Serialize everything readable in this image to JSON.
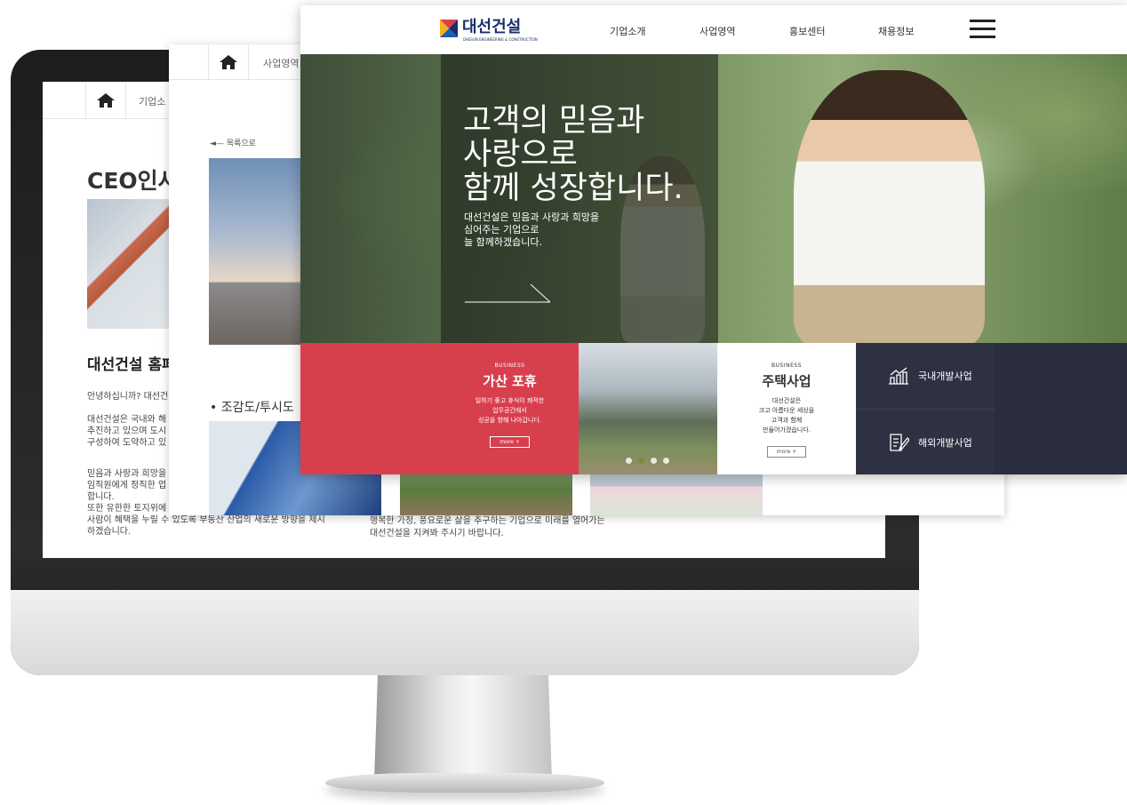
{
  "ceo_page": {
    "breadcrumb": "기업소",
    "title": "CEO인사",
    "heading": "대선건설 홈페",
    "para1": "안녕하십니까? 대선건",
    "para2": "대선건설은 국내와 해\n추진하고 있으며 도시\n구성하여 도약하고 있",
    "para3": "믿음과 사랑과 희망을\n임직원에게 정직한 업\n합니다.\n또한 유한한 토지위에 수많은 공동체를 만들어 문화의 어울림이 있는\n사람이 혜택을 누릴 수 있도록 부동산 산업의 새로운 방향을 제시\n하겠습니다."
  },
  "business_page": {
    "breadcrumb": "사업영역",
    "back_link": "◄— 목록으로",
    "section_title": "• 조감도/투시도",
    "bottom_text": "행복한 가정, 풍요로운 삶을 추구하는 기업으로 미래를 열어가는\n대선건설을 지켜봐 주시기 바랍니다."
  },
  "main_page": {
    "logo": {
      "name": "대선건설",
      "sub": "DAESUN ENGINEERING & CONSTRUCTION"
    },
    "menu": [
      "기업소개",
      "사업영역",
      "홍보센터",
      "채용정보"
    ],
    "hero": {
      "title": "고객의 믿음과\n사랑으로\n함께 성장합니다.",
      "description": "대선건설은 믿음과 사랑과 희망을\n심어주는 기업으로\n늘 함께하겠습니다."
    },
    "business_cards": [
      {
        "label": "BUSINESS",
        "title": "가산 포휴",
        "desc": "일하기 좋고 휴식이 쾌적한\n업무공간에서\n성공을 향해 나아갑니다.",
        "more": "more +"
      },
      {
        "label": "BUSINESS",
        "title": "주택사업",
        "desc": "대선건설은\n크고 아름다운 세상을\n고객과 함께\n만들어가겠습니다.",
        "more": "more +"
      }
    ],
    "links": [
      {
        "label": "국내개발사업",
        "icon": "chart-icon"
      },
      {
        "label": "해외개발사업",
        "icon": "document-edit-icon"
      }
    ],
    "slider_active_dot": 2
  },
  "colors": {
    "brand_navy": "#1a2f6d",
    "accent_red": "#d83f4d",
    "dark_navy": "#2e3142"
  }
}
